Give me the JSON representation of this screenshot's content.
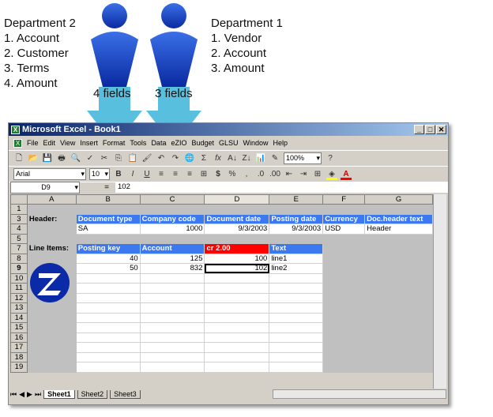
{
  "dept2": {
    "title": "Department 2",
    "items": [
      "1.  Account",
      "2.  Customer",
      "3.  Terms",
      "4.  Amount"
    ]
  },
  "dept1": {
    "title": "Department 1",
    "items": [
      "1.  Vendor",
      "2.  Account",
      "3.  Amount"
    ]
  },
  "fields_left": "4 fields",
  "fields_right": "3 fields",
  "window": {
    "title": "Microsoft Excel - Book1"
  },
  "menu": [
    "File",
    "Edit",
    "View",
    "Insert",
    "Format",
    "Tools",
    "Data",
    "eZIO",
    "Budget",
    "GLSU",
    "Window",
    "Help"
  ],
  "toolbar": {
    "zoom": "100%",
    "font": "Arial",
    "size": "10"
  },
  "formula": {
    "cell": "D9",
    "eq": "=",
    "value": "102"
  },
  "columns": [
    "",
    "A",
    "B",
    "C",
    "D",
    "E",
    "F",
    "G"
  ],
  "rows": [
    {
      "n": "1",
      "cells": [
        "",
        "",
        "",
        "",
        "",
        "",
        ""
      ]
    },
    {
      "n": "3",
      "cells": [
        "Header:",
        "Document type",
        "Company code",
        "Document date",
        "Posting date",
        "Currency",
        "Doc.header text"
      ]
    },
    {
      "n": "4",
      "cells": [
        "",
        "SA",
        "1000",
        "9/3/2003",
        "9/3/2003",
        "USD",
        "Header"
      ]
    },
    {
      "n": "5",
      "cells": [
        "",
        "",
        "",
        "",
        "",
        "",
        ""
      ]
    },
    {
      "n": "7",
      "cells": [
        "Line Items:",
        "Posting key",
        "Account",
        "cr 2.00",
        "Text",
        "",
        ""
      ]
    },
    {
      "n": "8",
      "cells": [
        "",
        "40",
        "125",
        "100",
        "line1",
        "",
        ""
      ]
    },
    {
      "n": "9",
      "cells": [
        "",
        "50",
        "832",
        "102",
        "line2",
        "",
        ""
      ]
    },
    {
      "n": "10"
    },
    {
      "n": "11"
    },
    {
      "n": "12"
    },
    {
      "n": "13"
    },
    {
      "n": "14"
    },
    {
      "n": "15"
    },
    {
      "n": "16"
    },
    {
      "n": "17"
    },
    {
      "n": "18"
    },
    {
      "n": "19"
    }
  ],
  "sheets": [
    "Sheet1",
    "Sheet2",
    "Sheet3"
  ],
  "colors": {
    "header_fill": "#3c78f0",
    "highlight": "#ff0000",
    "person": "#1a4fd0",
    "arrow": "#3cb4d8"
  }
}
